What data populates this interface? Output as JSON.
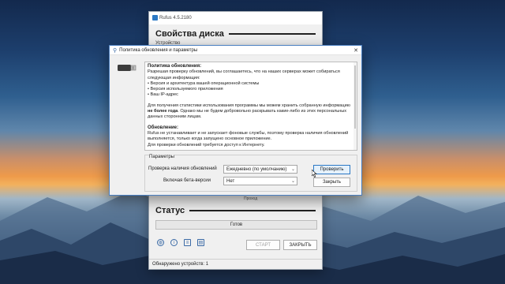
{
  "rufus": {
    "window_title": "Rufus 4.5.2180",
    "heading": "Свойства диска",
    "device_label": "Устройство",
    "crop_text": "Проход",
    "status_heading": "Статус",
    "progress_text": "Готов",
    "start_label": "СТАРТ",
    "close_label": "ЗАКРЫТЬ",
    "statusbar_text": "Обнаружено устройств: 1",
    "tool_icons": [
      "globe-icon",
      "info-icon",
      "settings-icon",
      "log-icon"
    ]
  },
  "dialog": {
    "title": "Политика обновления и параметры",
    "policy_title": "Политика обновления:",
    "policy_intro": "Разрешая проверку обновлений, вы соглашаетесь, что на наших серверах может собираться следующая информация:",
    "policy_items": [
      "• Версия и архитектура вашей операционной системы",
      "• Версия используемого приложения",
      "• Ваш IP-адрес"
    ],
    "policy_stats_before": "Для получения статистики использования программы мы можем хранить собранную информацию ",
    "policy_stats_bold": "не более года",
    "policy_stats_after": ". Однако мы не будем добровольно раскрывать какие-либо из этих персональных данных сторонним лицам.",
    "update_title": "Обновление:",
    "update_text": "Rufus не устанавливает и не запускает фоновые службы, поэтому проверка наличия обновлений выполняется, только когда запущено основное приложение.",
    "update_text2": "Для проверки обновлений требуется доступ к Интернету.",
    "params_legend": "Параметры",
    "check_label": "Проверка наличия обновлений",
    "check_value": "Ежедневно (по умолчанию)",
    "beta_label": "Включая бета-версии",
    "beta_value": "Нет",
    "check_button": "Проверить",
    "close_button": "Закрыть"
  },
  "colors": {
    "accent": "#2b78c4",
    "dialog_border": "#4a7fc1"
  }
}
